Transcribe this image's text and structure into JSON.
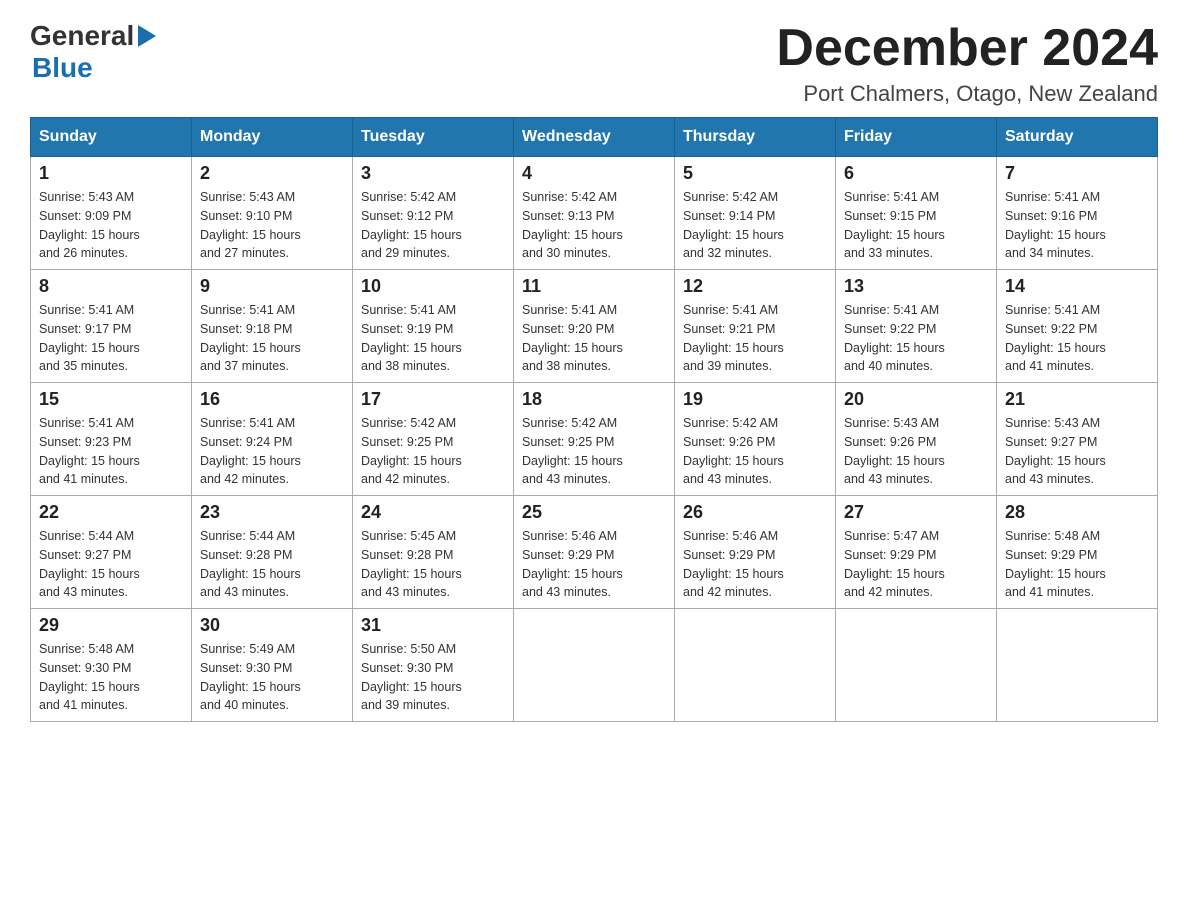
{
  "header": {
    "logo_general": "General",
    "logo_blue": "Blue",
    "month_title": "December 2024",
    "location": "Port Chalmers, Otago, New Zealand"
  },
  "days_of_week": [
    "Sunday",
    "Monday",
    "Tuesday",
    "Wednesday",
    "Thursday",
    "Friday",
    "Saturday"
  ],
  "weeks": [
    [
      {
        "day": "1",
        "sunrise": "5:43 AM",
        "sunset": "9:09 PM",
        "daylight": "15 hours and 26 minutes."
      },
      {
        "day": "2",
        "sunrise": "5:43 AM",
        "sunset": "9:10 PM",
        "daylight": "15 hours and 27 minutes."
      },
      {
        "day": "3",
        "sunrise": "5:42 AM",
        "sunset": "9:12 PM",
        "daylight": "15 hours and 29 minutes."
      },
      {
        "day": "4",
        "sunrise": "5:42 AM",
        "sunset": "9:13 PM",
        "daylight": "15 hours and 30 minutes."
      },
      {
        "day": "5",
        "sunrise": "5:42 AM",
        "sunset": "9:14 PM",
        "daylight": "15 hours and 32 minutes."
      },
      {
        "day": "6",
        "sunrise": "5:41 AM",
        "sunset": "9:15 PM",
        "daylight": "15 hours and 33 minutes."
      },
      {
        "day": "7",
        "sunrise": "5:41 AM",
        "sunset": "9:16 PM",
        "daylight": "15 hours and 34 minutes."
      }
    ],
    [
      {
        "day": "8",
        "sunrise": "5:41 AM",
        "sunset": "9:17 PM",
        "daylight": "15 hours and 35 minutes."
      },
      {
        "day": "9",
        "sunrise": "5:41 AM",
        "sunset": "9:18 PM",
        "daylight": "15 hours and 37 minutes."
      },
      {
        "day": "10",
        "sunrise": "5:41 AM",
        "sunset": "9:19 PM",
        "daylight": "15 hours and 38 minutes."
      },
      {
        "day": "11",
        "sunrise": "5:41 AM",
        "sunset": "9:20 PM",
        "daylight": "15 hours and 38 minutes."
      },
      {
        "day": "12",
        "sunrise": "5:41 AM",
        "sunset": "9:21 PM",
        "daylight": "15 hours and 39 minutes."
      },
      {
        "day": "13",
        "sunrise": "5:41 AM",
        "sunset": "9:22 PM",
        "daylight": "15 hours and 40 minutes."
      },
      {
        "day": "14",
        "sunrise": "5:41 AM",
        "sunset": "9:22 PM",
        "daylight": "15 hours and 41 minutes."
      }
    ],
    [
      {
        "day": "15",
        "sunrise": "5:41 AM",
        "sunset": "9:23 PM",
        "daylight": "15 hours and 41 minutes."
      },
      {
        "day": "16",
        "sunrise": "5:41 AM",
        "sunset": "9:24 PM",
        "daylight": "15 hours and 42 minutes."
      },
      {
        "day": "17",
        "sunrise": "5:42 AM",
        "sunset": "9:25 PM",
        "daylight": "15 hours and 42 minutes."
      },
      {
        "day": "18",
        "sunrise": "5:42 AM",
        "sunset": "9:25 PM",
        "daylight": "15 hours and 43 minutes."
      },
      {
        "day": "19",
        "sunrise": "5:42 AM",
        "sunset": "9:26 PM",
        "daylight": "15 hours and 43 minutes."
      },
      {
        "day": "20",
        "sunrise": "5:43 AM",
        "sunset": "9:26 PM",
        "daylight": "15 hours and 43 minutes."
      },
      {
        "day": "21",
        "sunrise": "5:43 AM",
        "sunset": "9:27 PM",
        "daylight": "15 hours and 43 minutes."
      }
    ],
    [
      {
        "day": "22",
        "sunrise": "5:44 AM",
        "sunset": "9:27 PM",
        "daylight": "15 hours and 43 minutes."
      },
      {
        "day": "23",
        "sunrise": "5:44 AM",
        "sunset": "9:28 PM",
        "daylight": "15 hours and 43 minutes."
      },
      {
        "day": "24",
        "sunrise": "5:45 AM",
        "sunset": "9:28 PM",
        "daylight": "15 hours and 43 minutes."
      },
      {
        "day": "25",
        "sunrise": "5:46 AM",
        "sunset": "9:29 PM",
        "daylight": "15 hours and 43 minutes."
      },
      {
        "day": "26",
        "sunrise": "5:46 AM",
        "sunset": "9:29 PM",
        "daylight": "15 hours and 42 minutes."
      },
      {
        "day": "27",
        "sunrise": "5:47 AM",
        "sunset": "9:29 PM",
        "daylight": "15 hours and 42 minutes."
      },
      {
        "day": "28",
        "sunrise": "5:48 AM",
        "sunset": "9:29 PM",
        "daylight": "15 hours and 41 minutes."
      }
    ],
    [
      {
        "day": "29",
        "sunrise": "5:48 AM",
        "sunset": "9:30 PM",
        "daylight": "15 hours and 41 minutes."
      },
      {
        "day": "30",
        "sunrise": "5:49 AM",
        "sunset": "9:30 PM",
        "daylight": "15 hours and 40 minutes."
      },
      {
        "day": "31",
        "sunrise": "5:50 AM",
        "sunset": "9:30 PM",
        "daylight": "15 hours and 39 minutes."
      },
      null,
      null,
      null,
      null
    ]
  ],
  "labels": {
    "sunrise": "Sunrise: ",
    "sunset": "Sunset: ",
    "daylight": "Daylight: "
  }
}
